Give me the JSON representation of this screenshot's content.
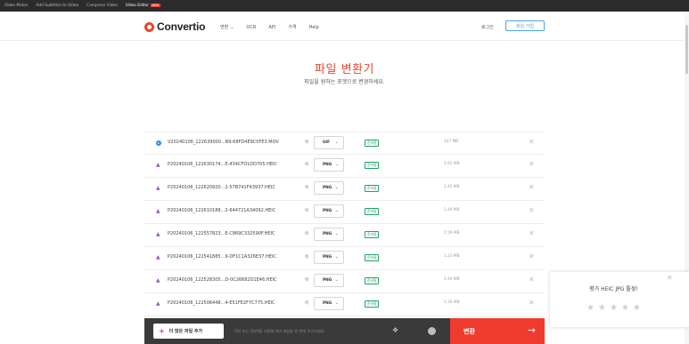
{
  "topbar": {
    "links": [
      "Video Maker",
      "Add Subtitles to Video",
      "Compress Video",
      "Video Editor"
    ],
    "new_badge": "NEW"
  },
  "header": {
    "logo_text": "Convertio",
    "nav": [
      "변환",
      "OCR",
      "API",
      "가격",
      "Help"
    ],
    "login": "로그인",
    "signup": "회원 가입"
  },
  "title": "파일 변환기",
  "subtitle": "파일을 원하는 포맷으로 변경하세요.",
  "files": [
    {
      "icon": "video-icon",
      "name": "V20240106_122639000...B9-68FD4E9C0FE3.MOV",
      "to": "에",
      "format": "GIF",
      "status": "준비됨",
      "size": "127 MB"
    },
    {
      "icon": "image-icon",
      "name": "P20240106_122630174...E-434CFD1DD705.HEIC",
      "to": "에",
      "format": "PNG",
      "status": "준비됨",
      "size": "1.61 MB"
    },
    {
      "icon": "image-icon",
      "name": "P20240106_122620920...2-57B741F43937.HEIC",
      "to": "에",
      "format": "PNG",
      "status": "준비됨",
      "size": "1.41 MB"
    },
    {
      "icon": "image-icon",
      "name": "P20240106_122610188...2-644721A34092.HEIC",
      "to": "에",
      "format": "PNG",
      "status": "준비됨",
      "size": "1.44 MB"
    },
    {
      "icon": "image-icon",
      "name": "P20240106_122557823...E-C869C332590F.HEIC",
      "to": "에",
      "format": "PNG",
      "status": "준비됨",
      "size": "1.56 MB"
    },
    {
      "icon": "image-icon",
      "name": "P20240106_122541885...9-DF1C1A326E37.HEIC",
      "to": "에",
      "format": "PNG",
      "status": "준비됨",
      "size": "1.23 MB"
    },
    {
      "icon": "image-icon",
      "name": "P20240106_122528305...D-0C26682D1E46.HEIC",
      "to": "에",
      "format": "PNG",
      "status": "준비됨",
      "size": "1.44 MB"
    },
    {
      "icon": "image-icon",
      "name": "P20240106_122506448...4-E51FE2F7C775.HEIC",
      "to": "에",
      "format": "PNG",
      "status": "준비됨",
      "size": "1.35 MB"
    }
  ],
  "bottombar": {
    "add_more": "더 많은 파일 추가",
    "hint": "Ctrl 또는 Shift를 사용해 여러 파일을 한 번에 추가하세요.",
    "convert": "변환",
    "arrow": "→"
  },
  "rating": {
    "title": "평가 HEIC JPG 툴젖!",
    "stars": 5
  },
  "colors": {
    "accent": "#e8462e",
    "topbar_bg": "#2c2c2c",
    "bottombar_bg": "#3a3a3a",
    "convert_bg": "#ee3b2e",
    "status_green": "#21a366",
    "signup_blue": "#4aa3df"
  }
}
